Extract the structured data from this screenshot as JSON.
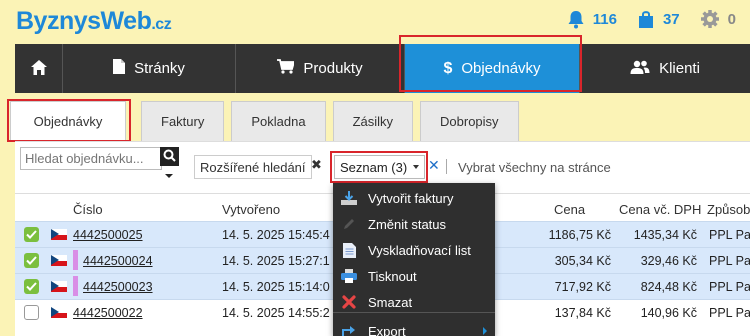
{
  "header": {
    "logo_main": "ByznysWeb",
    "logo_suffix": ".cz",
    "notifications_count": "116",
    "orders_count": "37",
    "settings_count": "0",
    "accent_color": "#1e88d8"
  },
  "nav": {
    "items": [
      {
        "label": "Stránky",
        "icon": "file-icon"
      },
      {
        "label": "Produkty",
        "icon": "cart-icon"
      },
      {
        "label": "Objednávky",
        "icon": "dollar-icon",
        "active": true
      },
      {
        "label": "Klienti",
        "icon": "users-icon"
      }
    ]
  },
  "tabs": [
    "Objednávky",
    "Faktury",
    "Pokladna",
    "Zásilky",
    "Dobropisy"
  ],
  "toolbar": {
    "search_placeholder": "Hledat objednávku...",
    "advanced_search": "Rozšířené hledání",
    "list_button": "Seznam (3)",
    "select_all": "Vybrat všechny na stránce"
  },
  "table": {
    "columns": [
      "Číslo",
      "Vytvořeno",
      "Cena",
      "Cena vč. DPH",
      "Způsob"
    ],
    "rows": [
      {
        "number": "4442500025",
        "created": "14. 5. 2025 15:45:4",
        "price": "1186,75 Kč",
        "price_vat": "1435,34 Kč",
        "method": "PPL Pa",
        "checked": true,
        "marked": false
      },
      {
        "number": "4442500024",
        "created": "14. 5. 2025 15:27:1",
        "price": "305,34 Kč",
        "price_vat": "329,46 Kč",
        "method": "PPL Pa",
        "checked": true,
        "marked": true
      },
      {
        "number": "4442500023",
        "created": "14. 5. 2025 15:14:0",
        "price": "717,92 Kč",
        "price_vat": "824,48 Kč",
        "method": "PPL Pa",
        "checked": true,
        "marked": true
      },
      {
        "number": "4442500022",
        "created": "14. 5. 2025 14:55:2",
        "price": "137,84 Kč",
        "price_vat": "140,96 Kč",
        "method": "PPL Pa",
        "checked": false,
        "marked": false
      }
    ]
  },
  "menu": {
    "items": [
      "Vytvořit faktury",
      "Změnit status",
      "Vyskladňovací list",
      "Tisknout",
      "Smazat",
      "Export"
    ]
  }
}
